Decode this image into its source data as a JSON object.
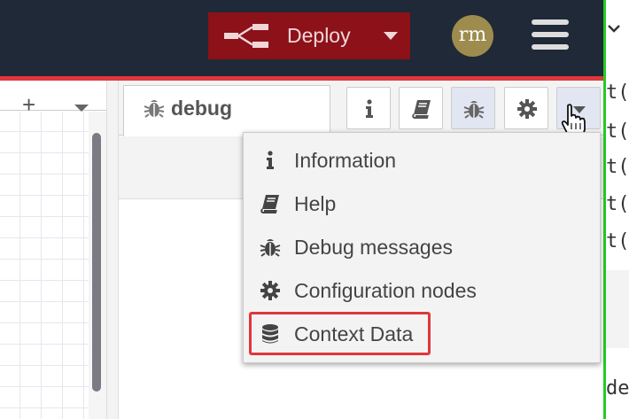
{
  "header": {
    "deploy_label": "Deploy",
    "avatar_initials": "rm",
    "icons": [
      "deploy-icon",
      "caret-down-icon",
      "hamburger-menu-icon",
      "chevron-down-icon"
    ]
  },
  "workspace": {
    "add_tab_label": "+"
  },
  "sidebar": {
    "active_tab_label": "debug",
    "tab_buttons": [
      {
        "name": "info-icon",
        "selected": false
      },
      {
        "name": "book-icon",
        "selected": false
      },
      {
        "name": "bug-icon",
        "selected": true
      },
      {
        "name": "gear-icon",
        "selected": false
      },
      {
        "name": "caret-down-icon",
        "selected": false
      }
    ]
  },
  "menu": {
    "items": [
      {
        "label": "Information",
        "icon": "info-icon"
      },
      {
        "label": "Help",
        "icon": "book-icon"
      },
      {
        "label": "Debug messages",
        "icon": "bug-icon"
      },
      {
        "label": "Configuration nodes",
        "icon": "gear-icon"
      },
      {
        "label": "Context Data",
        "icon": "database-icon",
        "highlighted": true
      }
    ]
  },
  "background_code": {
    "lines": [
      "t(",
      "t(",
      "t(",
      "t(",
      "t("
    ],
    "bottom_fragment": "de"
  },
  "colors": {
    "header_bg": "#1f2937",
    "deploy_bg": "#8c1119",
    "accent_red": "#e0363c",
    "avatar_bg": "#9e8c4e",
    "menu_bg": "#f3f3f3",
    "selected_tab_bg": "#e2e6f3",
    "frame_green": "#22cc22"
  }
}
